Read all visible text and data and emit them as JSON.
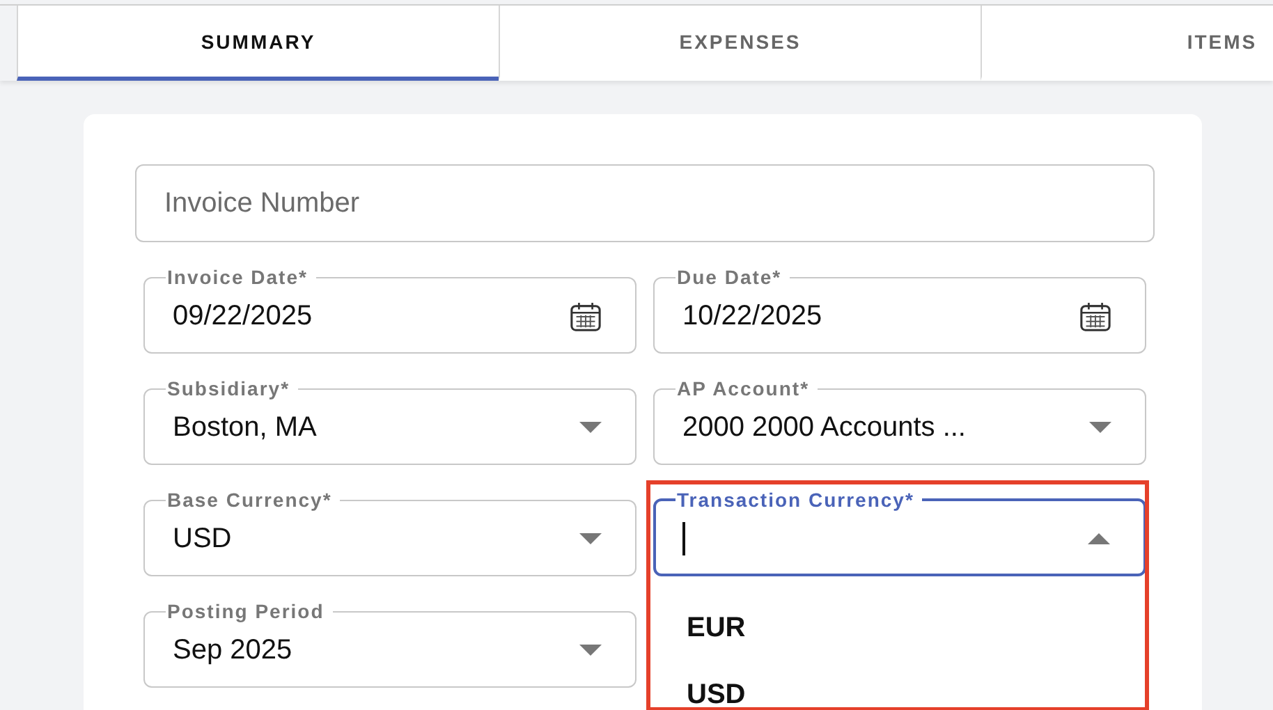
{
  "tabs": [
    {
      "label": "SUMMARY",
      "selected": true
    },
    {
      "label": "EXPENSES",
      "selected": false
    },
    {
      "label": "ITEMS",
      "selected": false
    }
  ],
  "invoice_number": {
    "placeholder": "Invoice Number"
  },
  "fields": [
    {
      "kind": "date",
      "label": "Invoice Date*",
      "value": "09/22/2025"
    },
    {
      "kind": "date",
      "label": "Due Date*",
      "value": "10/22/2025"
    },
    {
      "kind": "select",
      "label": "Subsidiary*",
      "value": "Boston, MA",
      "expanded": false,
      "focused": false,
      "highlighted": false
    },
    {
      "kind": "select",
      "label": "AP Account*",
      "value": "2000 2000 Accounts ...",
      "expanded": false,
      "focused": false,
      "highlighted": false
    },
    {
      "kind": "select",
      "label": "Base Currency*",
      "value": "USD",
      "expanded": false,
      "focused": false,
      "highlighted": false
    },
    {
      "kind": "select",
      "label": "Transaction Currency*",
      "expanded": true,
      "focused": true,
      "highlighted": true,
      "options": [
        "EUR",
        "USD"
      ]
    },
    {
      "kind": "select",
      "label": "Posting Period",
      "value": "Sep 2025",
      "expanded": false,
      "focused": false,
      "highlighted": false
    }
  ]
}
